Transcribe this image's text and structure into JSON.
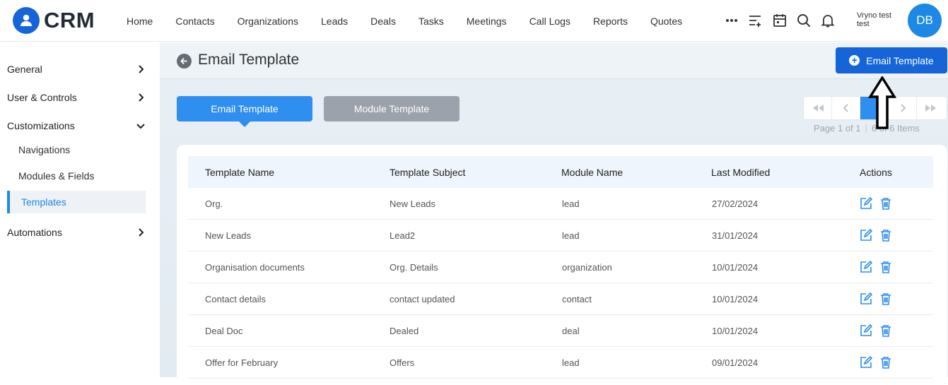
{
  "app": {
    "logo_text": "CRM",
    "brand_color": "#1565d8",
    "accent_color": "#2e8ff0"
  },
  "nav": [
    "Home",
    "Contacts",
    "Organizations",
    "Leads",
    "Deals",
    "Tasks",
    "Meetings",
    "Call Logs",
    "Reports",
    "Quotes"
  ],
  "top_icons": [
    "more-icon",
    "add-list-icon",
    "calendar-icon",
    "search-icon",
    "bell-icon"
  ],
  "user": {
    "name": "Vryno test test",
    "initials": "DB"
  },
  "sidebar": {
    "general": "General",
    "user_controls": "User & Controls",
    "customizations": "Customizations",
    "sub": [
      "Navigations",
      "Modules & Fields",
      "Templates"
    ],
    "active_sub": "Templates",
    "automations": "Automations"
  },
  "page": {
    "title": "Email Template",
    "add_button": "Email Template",
    "tabs": {
      "email": "Email Template",
      "module": "Module Template"
    }
  },
  "pager": {
    "page_text": "Page 1 of 1",
    "items_text": "6 of 6 Items"
  },
  "table": {
    "headers": [
      "Template Name",
      "Template Subject",
      "Module Name",
      "Last Modified",
      "Actions"
    ],
    "rows": [
      [
        "Org.",
        "New Leads",
        "lead",
        "27/02/2024"
      ],
      [
        "New Leads",
        "Lead2",
        "lead",
        "31/01/2024"
      ],
      [
        "Organisation documents",
        "Org. Details",
        "organization",
        "10/01/2024"
      ],
      [
        "Contact details",
        "contact updated",
        "contact",
        "10/01/2024"
      ],
      [
        "Deal Doc",
        "Dealed",
        "deal",
        "10/01/2024"
      ],
      [
        "Offer for February",
        "Offers",
        "lead",
        "09/01/2024"
      ]
    ]
  }
}
